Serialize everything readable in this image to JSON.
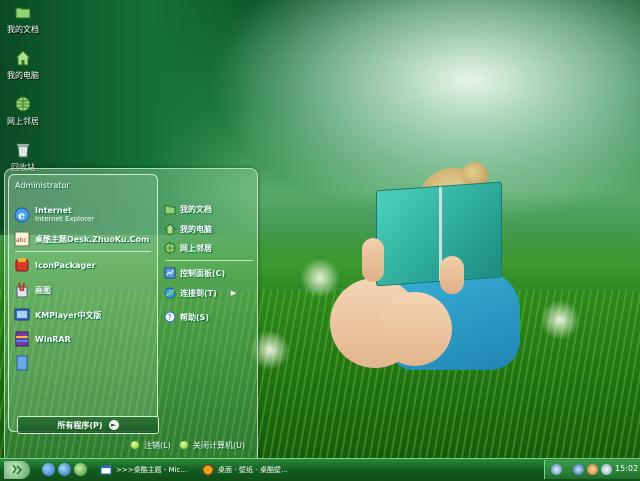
{
  "desktop": {
    "icons": [
      {
        "label": "我的文档",
        "icon": "folder-icon"
      },
      {
        "label": "我的电脑",
        "icon": "home-icon"
      },
      {
        "label": "网上邻居",
        "icon": "globe-icon"
      },
      {
        "label": "回收站",
        "icon": "recycle-bin-icon"
      }
    ]
  },
  "start_menu": {
    "user_name": "Administrator",
    "pinned": [
      {
        "title": "Internet",
        "subtitle": "Internet Explorer"
      },
      {
        "title": "桌酷主题Desk.ZhuoKu.Com"
      }
    ],
    "recent": [
      {
        "title": "IconPackager"
      },
      {
        "title": "画图"
      },
      {
        "title": "KMPlayer中文版"
      },
      {
        "title": "WinRAR"
      },
      {
        "title": ""
      }
    ],
    "all_programs": "所有程序(P)",
    "right_items": [
      {
        "title": "我的文档"
      },
      {
        "title": "我的电脑"
      },
      {
        "title": "网上邻居"
      },
      {
        "title": "控制面板(C)"
      },
      {
        "title": "连接到(T)",
        "has_arrow": true
      },
      {
        "title": "帮助(S)"
      }
    ],
    "logoff": "注销(L)",
    "shutdown": "关闭计算机(U)"
  },
  "taskbar": {
    "tasks": [
      {
        "title": ">>>桌酷主题 - Mic..."
      },
      {
        "title": "桌面 - 壁纸 - 桌酷壁..."
      }
    ],
    "clock": "15:02"
  },
  "colors": {
    "accent": "#1d7a3e",
    "taskbar": "#145e22",
    "menu_border": "#d2fad7"
  }
}
